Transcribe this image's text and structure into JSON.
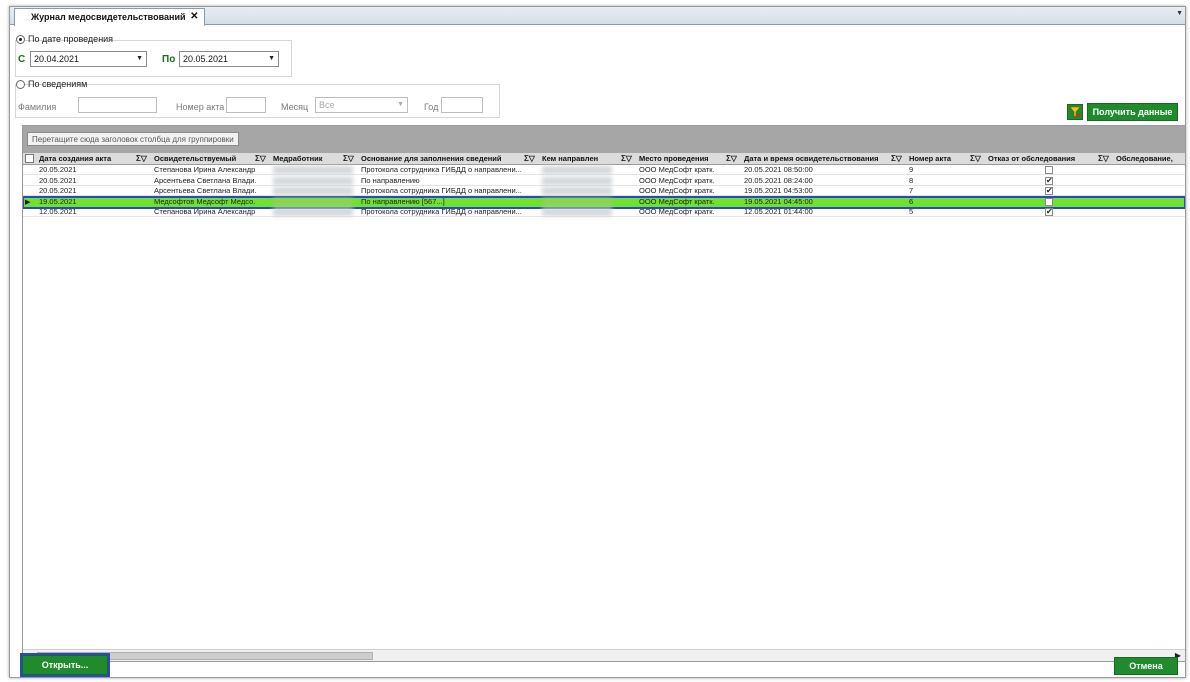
{
  "tab": {
    "title": "Журнал медосвидетельствований",
    "close": "✕"
  },
  "period": {
    "radio_label": "По дате проведения",
    "from_label": "С",
    "from_value": "20.04.2021",
    "to_label": "По",
    "to_value": "20.05.2021"
  },
  "info": {
    "radio_label": "По сведениям",
    "surname_label": "Фамилия",
    "act_label": "Номер акта",
    "month_label": "Месяц",
    "month_value": "Все",
    "year_label": "Год"
  },
  "toolbar": {
    "get_data_label": "Получить данные"
  },
  "grid": {
    "group_hint": "Перетащите сюда заголовок столбца для группировки",
    "columns": [
      "Дата создания акта",
      "Освидетельствуемый",
      "Медработник",
      "Основание для заполнения сведений",
      "Кем направлен",
      "Место проведения",
      "Дата и время освидетельствования",
      "Номер акта",
      "Отказ от обследования",
      "Обследование,"
    ],
    "rows": [
      {
        "created": "20.05.2021",
        "person": "Степанова Ирина Александр...",
        "reason": "Протокола сотрудника ГИБДД о направлени...",
        "place": "ООО МедСофт кратк.",
        "datetime": "20.05.2021 08:50:00",
        "act": "9",
        "refusal": false,
        "selected": false
      },
      {
        "created": "20.05.2021",
        "person": "Арсентьева Светлана Влади...",
        "reason": "По направлению",
        "place": "ООО МедСофт кратк.",
        "datetime": "20.05.2021 08:24:00",
        "act": "8",
        "refusal": true,
        "selected": false
      },
      {
        "created": "20.05.2021",
        "person": "Арсентьева Светлана Влади...",
        "reason": "Протокола сотрудника ГИБДД о направлени...",
        "place": "ООО МедСофт кратк.",
        "datetime": "19.05.2021 04:53:00",
        "act": "7",
        "refusal": true,
        "selected": false
      },
      {
        "created": "19.05.2021",
        "person": "Медсофтов Медсофт Медсо...",
        "reason": "По направлению [567...]",
        "place": "ООО МедСофт кратк.",
        "datetime": "19.05.2021 04:45:00",
        "act": "6",
        "refusal": false,
        "selected": true
      },
      {
        "created": "12.05.2021",
        "person": "Степанова Ирина Александр...",
        "reason": "Протокола сотрудника ГИБДД о направлени...",
        "place": "ООО МедСофт кратк.",
        "datetime": "12.05.2021 01:44:00",
        "act": "5",
        "refusal": true,
        "selected": false
      }
    ]
  },
  "footer": {
    "open_label": "Открыть...",
    "cancel_label": "Отмена"
  },
  "colors": {
    "accent_green": "#1f8b2c",
    "selected_row": "#6fe12f",
    "focus_blue": "#2a47c9"
  }
}
